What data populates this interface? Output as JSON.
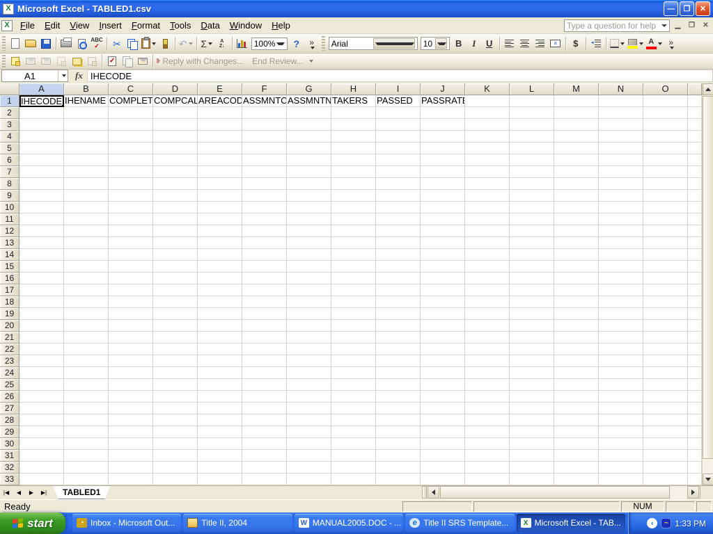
{
  "window": {
    "title": "Microsoft Excel - TABLED1.csv"
  },
  "menu": {
    "items": [
      "File",
      "Edit",
      "View",
      "Insert",
      "Format",
      "Tools",
      "Data",
      "Window",
      "Help"
    ],
    "help_placeholder": "Type a question for help"
  },
  "toolbars": {
    "standard": {
      "zoom_value": "100%",
      "autosum_glyph": "Σ",
      "cut_glyph": "✂",
      "undo_glyph": "↶",
      "help_glyph": "?",
      "more_glyph": "»",
      "spell_top": "ABC",
      "spell_check": "✓",
      "sort_top": "A",
      "sort_bottom": "Z↓"
    },
    "formatting": {
      "font_name": "Arial",
      "font_size": "10",
      "bold": "B",
      "italic": "I",
      "underline": "U",
      "currency": "$",
      "merge_glyph": "a",
      "font_color_letter": "A",
      "more_glyph": "»"
    },
    "reviewing": {
      "reply_label": "Reply with Changes...",
      "end_review_label": "End Review...",
      "flag_glyph": "❥"
    }
  },
  "formula_bar": {
    "name_box": "A1",
    "fx_label": "fx",
    "formula": "IHECODE"
  },
  "grid": {
    "columns": [
      "A",
      "B",
      "C",
      "D",
      "E",
      "F",
      "G",
      "H",
      "I",
      "J",
      "K",
      "L",
      "M",
      "N",
      "O"
    ],
    "row_count": 33,
    "selected_cell": "A1",
    "selected_column": "A",
    "selected_row": 1,
    "row1_values": [
      "IHECODE",
      "IHENAME",
      "COMPLETE",
      "COMPCALC",
      "AREACODE",
      "ASSMNTCD",
      "ASSMNTNM",
      "TAKERS",
      "PASSED",
      "PASSRATE"
    ]
  },
  "sheet_tabs": {
    "active_tab": "TABLED1"
  },
  "status_bar": {
    "mode": "Ready",
    "num_indicator": "NUM"
  },
  "taskbar": {
    "start_label": "start",
    "items": [
      {
        "label": "Inbox - Microsoft Out...",
        "icon": "outlook",
        "active": false
      },
      {
        "label": "Title II, 2004",
        "icon": "folder",
        "active": false
      },
      {
        "label": "MANUAL2005.DOC - ...",
        "icon": "word",
        "active": false
      },
      {
        "label": "Title II SRS Template...",
        "icon": "ie",
        "active": false
      },
      {
        "label": "Microsoft Excel - TAB...",
        "icon": "excel",
        "active": true
      }
    ],
    "clock": "1:33 PM"
  },
  "colors": {
    "titlebar_blue": "#2A66E6",
    "chrome_beige": "#ECE9D8",
    "taskbar_blue": "#2E6FE9",
    "start_green": "#3C9F26",
    "selection_header_blue": "#C4D2EE",
    "fill_color_swatch": "#FFFF00",
    "font_color_swatch": "#FF0000",
    "close_red": "#E1582B"
  }
}
